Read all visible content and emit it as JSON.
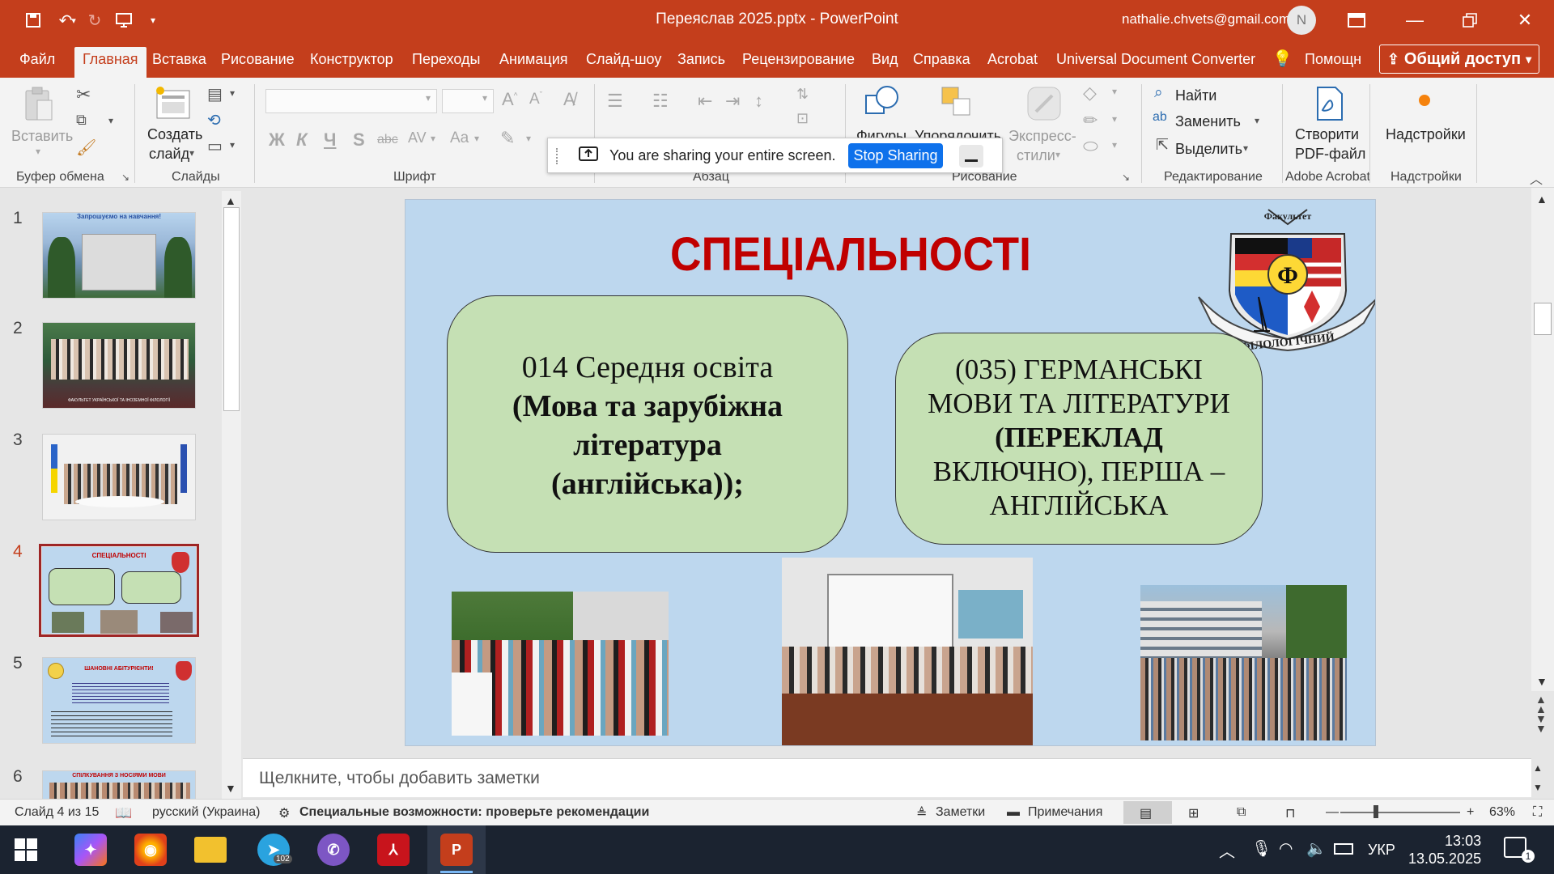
{
  "titlebar": {
    "doc_title": "Переяслав 2025.pptx  -  PowerPoint",
    "account_email": "nathalie.chvets@gmail.com",
    "avatar_initial": "N"
  },
  "tabs": [
    "Файл",
    "Главная",
    "Вставка",
    "Рисование",
    "Конструктор",
    "Переходы",
    "Анимация",
    "Слайд-шоу",
    "Запись",
    "Рецензирование",
    "Вид",
    "Справка",
    "Acrobat",
    "Universal Document Converter"
  ],
  "active_tab": "Главная",
  "help_label": "Помощн",
  "share_label": "Общий доступ",
  "ribbon": {
    "paste": "Вставить",
    "new_slide_line1": "Создать",
    "new_slide_line2": "слайд",
    "find": "Найти",
    "replace": "Заменить",
    "select": "Выделить",
    "create_pdf_line1": "Створити",
    "create_pdf_line2": "PDF-файл",
    "addins": "Надстройки",
    "shapes": "Фигуры",
    "arrange": "Упорядочить",
    "express_line1": "Экспресс-",
    "express_line2": "стили",
    "font_bold": "Ж",
    "font_italic": "К",
    "font_underline": "Ч",
    "font_strike": "S",
    "groups": {
      "clipboard": "Буфер обмена",
      "slides": "Слайды",
      "font": "Шрифт",
      "paragraph": "Абзац",
      "drawing": "Рисование",
      "editing": "Редактирование",
      "acrobat": "Adobe Acrobat",
      "addins": "Надстройки"
    }
  },
  "sharing_bar": {
    "message": "You are sharing your entire screen.",
    "stop_label": "Stop Sharing"
  },
  "thumbnails": [
    {
      "num": "1",
      "caption": "Запрошуємо на навчання!"
    },
    {
      "num": "2",
      "caption": "ФАКУЛЬТЕТ УКРАЇНСЬКОЇ ТА ІНОЗЕМНОЇ ФІЛОЛОГІЇ"
    },
    {
      "num": "3",
      "caption": ""
    },
    {
      "num": "4",
      "caption": "СПЕЦІАЛЬНОСТІ"
    },
    {
      "num": "5",
      "caption": "ШАНОВНІ АБІТУРІЄНТИ!"
    },
    {
      "num": "6",
      "caption": "СПІЛКУВАННЯ З НОСІЯМИ МОВИ"
    }
  ],
  "slide": {
    "title": "СПЕЦІАЛЬНОСТІ",
    "box1_line1": "014 Середня освіта",
    "box1_line2": "(Мова та зарубіжна",
    "box1_line3": "література",
    "box1_line4": "(англійська));",
    "box2_line1": "(035) ГЕРМАНСЬКІ",
    "box2_line2": "МОВИ ТА ЛІТЕРАТУРИ",
    "box2_line3": "(ПЕРЕКЛАД",
    "box2_line4": "ВКЛЮЧНО), ПЕРША –",
    "box2_line5": "АНГЛІЙСЬКА",
    "emblem_top": "Факультет",
    "emblem_ribbon": "ФІЛОЛОГІЧНИЙ",
    "emblem_letter": "Ф"
  },
  "notes_placeholder": "Щелкните, чтобы добавить заметки",
  "status": {
    "slide_info": "Слайд 4 из 15",
    "language": "русский (Украина)",
    "accessibility": "Специальные возможности: проверьте рекомендации",
    "notes": "Заметки",
    "comments": "Примечания",
    "zoom": "63%"
  },
  "taskbar": {
    "language": "УКР",
    "time": "13:03",
    "date": "13.05.2025",
    "telegram_badge": "102",
    "notification_count": "1"
  },
  "colors": {
    "accent": "#c43e1c",
    "slide_bg": "#bdd7ee",
    "box_fill": "#c5e0b4",
    "title_red": "#c00000",
    "stop_sharing": "#0e71eb"
  }
}
